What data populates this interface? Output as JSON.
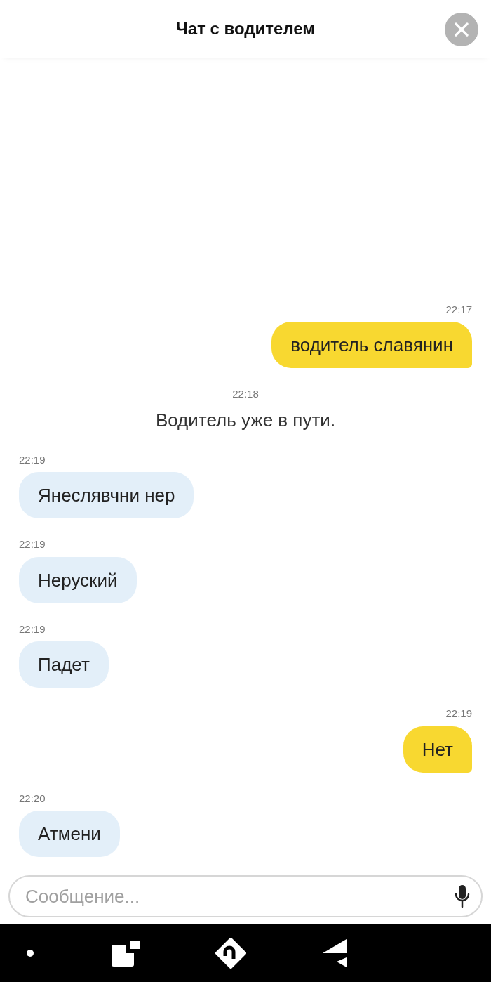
{
  "header": {
    "title": "Чат с водителем"
  },
  "messages": [
    {
      "kind": "outgoing",
      "time": "22:17",
      "text": "водитель славянин"
    },
    {
      "kind": "system",
      "time": "22:18",
      "text": "Водитель уже в пути."
    },
    {
      "kind": "incoming",
      "time": "22:19",
      "text": "Янеслявчни нер"
    },
    {
      "kind": "incoming",
      "time": "22:19",
      "text": "Неруский"
    },
    {
      "kind": "incoming",
      "time": "22:19",
      "text": "Падет"
    },
    {
      "kind": "outgoing",
      "time": "22:19",
      "text": "Нет"
    },
    {
      "kind": "incoming",
      "time": "22:20",
      "text": "Атмени"
    }
  ],
  "composer": {
    "placeholder": "Сообщение..."
  }
}
